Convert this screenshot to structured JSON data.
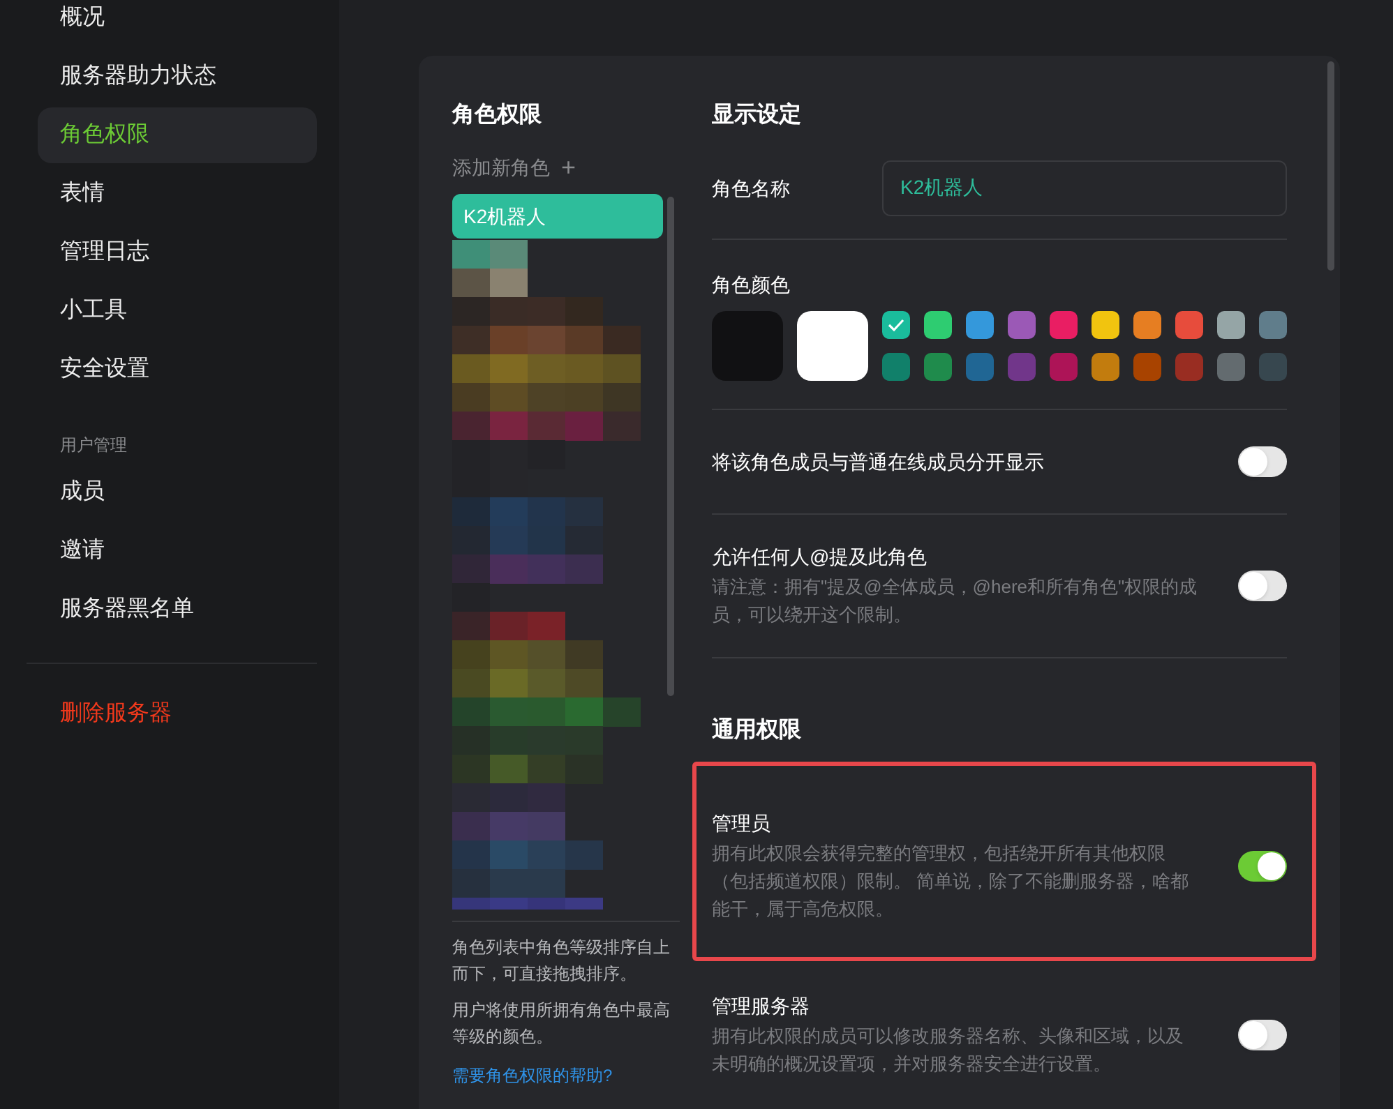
{
  "sidebar": {
    "items": [
      {
        "kind": "item",
        "label": "概况",
        "selected": false
      },
      {
        "kind": "item",
        "label": "服务器助力状态",
        "selected": false
      },
      {
        "kind": "item",
        "label": "角色权限",
        "selected": true
      },
      {
        "kind": "item",
        "label": "表情",
        "selected": false
      },
      {
        "kind": "item",
        "label": "管理日志",
        "selected": false
      },
      {
        "kind": "item",
        "label": "小工具",
        "selected": false
      },
      {
        "kind": "item",
        "label": "安全设置",
        "selected": false
      },
      {
        "kind": "header",
        "label": "用户管理"
      },
      {
        "kind": "item",
        "label": "成员",
        "selected": false
      },
      {
        "kind": "item",
        "label": "邀请",
        "selected": false
      },
      {
        "kind": "item",
        "label": "服务器黑名单",
        "selected": false
      },
      {
        "kind": "divider"
      },
      {
        "kind": "danger",
        "label": "删除服务器",
        "selected": false
      }
    ]
  },
  "roles": {
    "title": "角色权限",
    "add_label": "添加新角色",
    "add_icon": "+",
    "items": [
      {
        "label": "K2机器人",
        "selected": true
      }
    ],
    "notes": [
      "角色列表中角色等级排序自上而下，可直接拖拽排序。",
      "用户将使用所拥有角色中最高等级的颜色。"
    ],
    "help_link": "需要角色权限的帮助?"
  },
  "display": {
    "title": "显示设定",
    "name_label": "角色名称",
    "name_value": "K2机器人",
    "color_label": "角色颜色",
    "big_swatches": [
      {
        "color": "#111113",
        "selected": false
      },
      {
        "color": "#ffffff",
        "selected": false
      }
    ],
    "swatches": [
      {
        "color": "#1abc9c",
        "selected": true
      },
      {
        "color": "#2ecc71",
        "selected": false
      },
      {
        "color": "#3498db",
        "selected": false
      },
      {
        "color": "#9b59b6",
        "selected": false
      },
      {
        "color": "#e91e63",
        "selected": false
      },
      {
        "color": "#f1c40f",
        "selected": false
      },
      {
        "color": "#e67e22",
        "selected": false
      },
      {
        "color": "#e74c3c",
        "selected": false
      },
      {
        "color": "#95a5a6",
        "selected": false
      },
      {
        "color": "#607d8b",
        "selected": false
      },
      {
        "color": "#11806a",
        "selected": false
      },
      {
        "color": "#1f8b4c",
        "selected": false
      },
      {
        "color": "#206694",
        "selected": false
      },
      {
        "color": "#71368a",
        "selected": false
      },
      {
        "color": "#ad1457",
        "selected": false
      },
      {
        "color": "#c27c0e",
        "selected": false
      },
      {
        "color": "#a84300",
        "selected": false
      },
      {
        "color": "#992d22",
        "selected": false
      },
      {
        "color": "#636b6f",
        "selected": false
      },
      {
        "color": "#37474f",
        "selected": false
      }
    ],
    "toggles": [
      {
        "title": "将该角色成员与普通在线成员分开显示",
        "on": false
      },
      {
        "title": "允许任何人@提及此角色",
        "description": "请注意：拥有\"提及@全体成员，@here和所有角色\"权限的成员，可以绕开这个限制。",
        "on": false
      }
    ]
  },
  "general": {
    "title": "通用权限",
    "permissions": [
      {
        "title": "管理员",
        "description": "拥有此权限会获得完整的管理权，包括绕开所有其他权限（包括频道权限）限制。 简单说，除了不能删服务器，啥都能干，属于高危权限。",
        "on": true,
        "highlighted": true
      },
      {
        "title": "管理服务器",
        "description": "拥有此权限的成员可以修改服务器名称、头像和区域，以及未明确的概况设置项，并对服务器安全进行设置。",
        "on": false,
        "highlighted": false
      }
    ]
  }
}
